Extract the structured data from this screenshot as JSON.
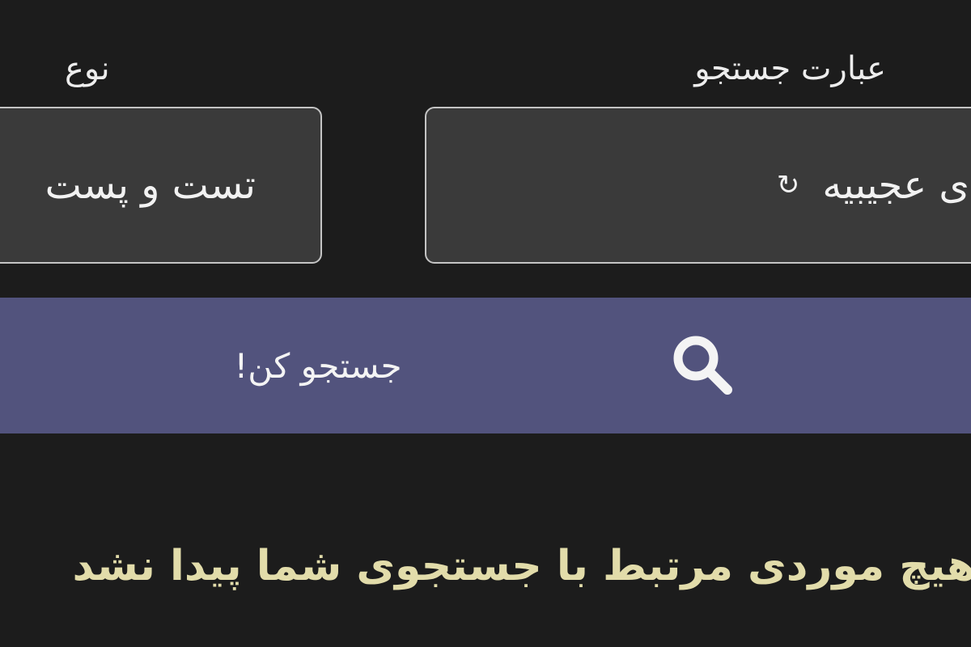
{
  "form": {
    "query_label": "عبارت جستجو",
    "query_value": "ی عجیبیه",
    "type_label": "نوع",
    "type_value": "تست و پست",
    "refresh_icon": "refresh-icon",
    "search_icon": "search-icon",
    "search_button_label": "جستجو کن!"
  },
  "results": {
    "empty_message": "هیچ موردی مرتبط با جستجوی شما پیدا نشد"
  },
  "colors": {
    "background": "#1c1c1c",
    "field_background": "#3a3a3a",
    "button_background": "#52537d",
    "message_text": "#e2dcaa"
  }
}
